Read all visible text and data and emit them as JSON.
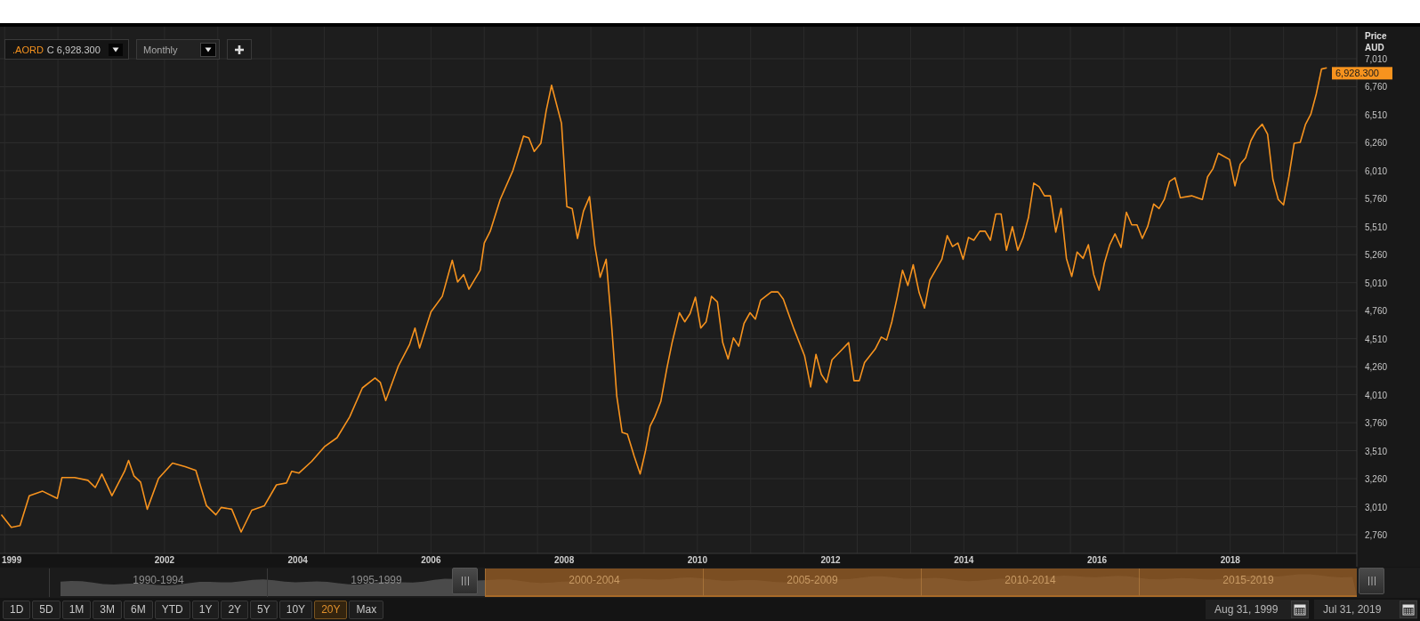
{
  "symbol_selector": {
    "price_label": "C 6,928.300"
  },
  "interval_dropdown": {
    "value": "Monthly"
  },
  "price_axis": {
    "title": "Price",
    "currency": "AUD",
    "last_price": "6,928.300"
  },
  "chart_data": {
    "type": "line",
    "grid": true,
    "xlim": [
      1999.53,
      2019.9
    ],
    "ylim": [
      2593,
      7296
    ],
    "x": [
      1999.55,
      1999.7,
      1999.83,
      1999.97,
      2000.17,
      2000.39,
      2000.46,
      2000.65,
      2000.85,
      2000.96,
      2001.06,
      2001.21,
      2001.4,
      2001.46,
      2001.54,
      2001.64,
      2001.74,
      2001.91,
      2002.12,
      2002.31,
      2002.47,
      2002.63,
      2002.77,
      2002.85,
      2003.01,
      2003.15,
      2003.31,
      2003.5,
      2003.68,
      2003.83,
      2003.91,
      2004.02,
      2004.21,
      2004.4,
      2004.59,
      2004.78,
      2004.97,
      2005.16,
      2005.24,
      2005.32,
      2005.51,
      2005.68,
      2005.76,
      2005.83,
      2006.0,
      2006.17,
      2006.32,
      2006.4,
      2006.49,
      2006.57,
      2006.74,
      2006.8,
      2006.89,
      2007.04,
      2007.23,
      2007.39,
      2007.47,
      2007.55,
      2007.65,
      2007.73,
      2007.81,
      2007.96,
      2008.04,
      2008.12,
      2008.2,
      2008.29,
      2008.38,
      2008.46,
      2008.54,
      2008.63,
      2008.71,
      2008.79,
      2008.87,
      2008.95,
      2009.05,
      2009.14,
      2009.22,
      2009.29,
      2009.36,
      2009.45,
      2009.54,
      2009.62,
      2009.73,
      2009.81,
      2009.89,
      2009.97,
      2010.05,
      2010.13,
      2010.21,
      2010.3,
      2010.38,
      2010.46,
      2010.54,
      2010.62,
      2010.7,
      2010.79,
      2010.87,
      2010.95,
      2011.11,
      2011.21,
      2011.29,
      2011.45,
      2011.61,
      2011.7,
      2011.78,
      2011.86,
      2011.94,
      2012.02,
      2012.18,
      2012.27,
      2012.35,
      2012.43,
      2012.51,
      2012.67,
      2012.76,
      2012.84,
      2012.92,
      2013.0,
      2013.08,
      2013.16,
      2013.24,
      2013.33,
      2013.41,
      2013.49,
      2013.67,
      2013.75,
      2013.83,
      2013.91,
      2013.99,
      2014.07,
      2014.15,
      2014.24,
      2014.32,
      2014.4,
      2014.48,
      2014.56,
      2014.64,
      2014.73,
      2014.81,
      2014.89,
      2014.97,
      2015.05,
      2015.13,
      2015.21,
      2015.3,
      2015.38,
      2015.46,
      2015.54,
      2015.62,
      2015.7,
      2015.79,
      2015.87,
      2015.95,
      2016.03,
      2016.11,
      2016.19,
      2016.27,
      2016.36,
      2016.44,
      2016.52,
      2016.6,
      2016.68,
      2016.76,
      2016.85,
      2016.93,
      2017.01,
      2017.09,
      2017.17,
      2017.25,
      2017.42,
      2017.58,
      2017.66,
      2017.74,
      2017.82,
      2017.99,
      2018.07,
      2018.15,
      2018.23,
      2018.31,
      2018.39,
      2018.48,
      2018.56,
      2018.64,
      2018.72,
      2018.8,
      2018.88,
      2018.96,
      2019.05,
      2019.13,
      2019.21,
      2019.29,
      2019.37,
      2019.45
    ],
    "series": [
      {
        "name": ".AORD",
        "color": "#f7931e",
        "values": [
          2938,
          2825,
          2841,
          3108,
          3148,
          3084,
          3270,
          3270,
          3245,
          3181,
          3302,
          3108,
          3326,
          3423,
          3286,
          3229,
          2987,
          3262,
          3399,
          3367,
          3334,
          3019,
          2938,
          3003,
          2987,
          2784,
          2978,
          3019,
          3205,
          3221,
          3326,
          3310,
          3415,
          3545,
          3626,
          3812,
          4071,
          4160,
          4119,
          3957,
          4265,
          4459,
          4605,
          4427,
          4750,
          4888,
          5211,
          5017,
          5082,
          4952,
          5122,
          5365,
          5470,
          5753,
          6012,
          6320,
          6303,
          6182,
          6255,
          6546,
          6773,
          6433,
          5689,
          5672,
          5405,
          5648,
          5778,
          5341,
          5058,
          5219,
          4645,
          3998,
          3674,
          3658,
          3464,
          3302,
          3504,
          3731,
          3812,
          3949,
          4240,
          4475,
          4742,
          4661,
          4734,
          4880,
          4605,
          4661,
          4888,
          4839,
          4475,
          4329,
          4516,
          4443,
          4645,
          4742,
          4685,
          4855,
          4928,
          4928,
          4863,
          4596,
          4354,
          4079,
          4370,
          4192,
          4119,
          4321,
          4418,
          4475,
          4135,
          4135,
          4297,
          4418,
          4524,
          4499,
          4661,
          4880,
          5122,
          4985,
          5171,
          4920,
          4783,
          5033,
          5219,
          5430,
          5333,
          5365,
          5219,
          5414,
          5389,
          5470,
          5470,
          5389,
          5624,
          5624,
          5300,
          5511,
          5300,
          5414,
          5592,
          5899,
          5867,
          5786,
          5786,
          5462,
          5672,
          5227,
          5066,
          5284,
          5227,
          5349,
          5082,
          4944,
          5187,
          5349,
          5446,
          5325,
          5640,
          5527,
          5527,
          5405,
          5511,
          5713,
          5672,
          5753,
          5915,
          5947,
          5769,
          5786,
          5753,
          5956,
          6028,
          6166,
          6109,
          5875,
          6069,
          6125,
          6279,
          6368,
          6425,
          6336,
          5931,
          5753,
          5705,
          5956,
          6255,
          6263,
          6425,
          6514,
          6692,
          6918,
          6928
        ]
      }
    ],
    "yticks": [
      {
        "value": 2760,
        "label": "2,760"
      },
      {
        "value": 3010,
        "label": "3,010"
      },
      {
        "value": 3260,
        "label": "3,260"
      },
      {
        "value": 3510,
        "label": "3,510"
      },
      {
        "value": 3760,
        "label": "3,760"
      },
      {
        "value": 4010,
        "label": "4,010"
      },
      {
        "value": 4260,
        "label": "4,260"
      },
      {
        "value": 4510,
        "label": "4,510"
      },
      {
        "value": 4760,
        "label": "4,760"
      },
      {
        "value": 5010,
        "label": "5,010"
      },
      {
        "value": 5260,
        "label": "5,260"
      },
      {
        "value": 5510,
        "label": "5,510"
      },
      {
        "value": 5760,
        "label": "5,760"
      },
      {
        "value": 6010,
        "label": "6,010"
      },
      {
        "value": 6260,
        "label": "6,260"
      },
      {
        "value": 6510,
        "label": "6,510"
      },
      {
        "value": 6760,
        "label": "6,760"
      },
      {
        "value": 7010,
        "label": "7,010"
      }
    ],
    "xticks": [
      2002,
      2004,
      2006,
      2008,
      2010,
      2012,
      2014,
      2016,
      2018
    ]
  },
  "x_axis_start_label": "1999",
  "navigator": {
    "periods": [
      {
        "label": "1990-1994",
        "selected": false
      },
      {
        "label": "1995-1999",
        "selected": false
      },
      {
        "label": "2000-2004",
        "selected": true
      },
      {
        "label": "2005-2009",
        "selected": true
      },
      {
        "label": "2010-2014",
        "selected": true
      },
      {
        "label": "2015-2019",
        "selected": true
      }
    ]
  },
  "range_buttons": [
    {
      "label": "1D",
      "selected": false
    },
    {
      "label": "5D",
      "selected": false
    },
    {
      "label": "1M",
      "selected": false
    },
    {
      "label": "3M",
      "selected": false
    },
    {
      "label": "6M",
      "selected": false
    },
    {
      "label": "YTD",
      "selected": false
    },
    {
      "label": "1Y",
      "selected": false
    },
    {
      "label": "2Y",
      "selected": false
    },
    {
      "label": "5Y",
      "selected": false
    },
    {
      "label": "10Y",
      "selected": false
    },
    {
      "label": "20Y",
      "selected": true
    },
    {
      "label": "Max",
      "selected": false
    }
  ],
  "date_range": {
    "start": "Aug 31, 1999",
    "end": "Jul 31, 2019"
  }
}
